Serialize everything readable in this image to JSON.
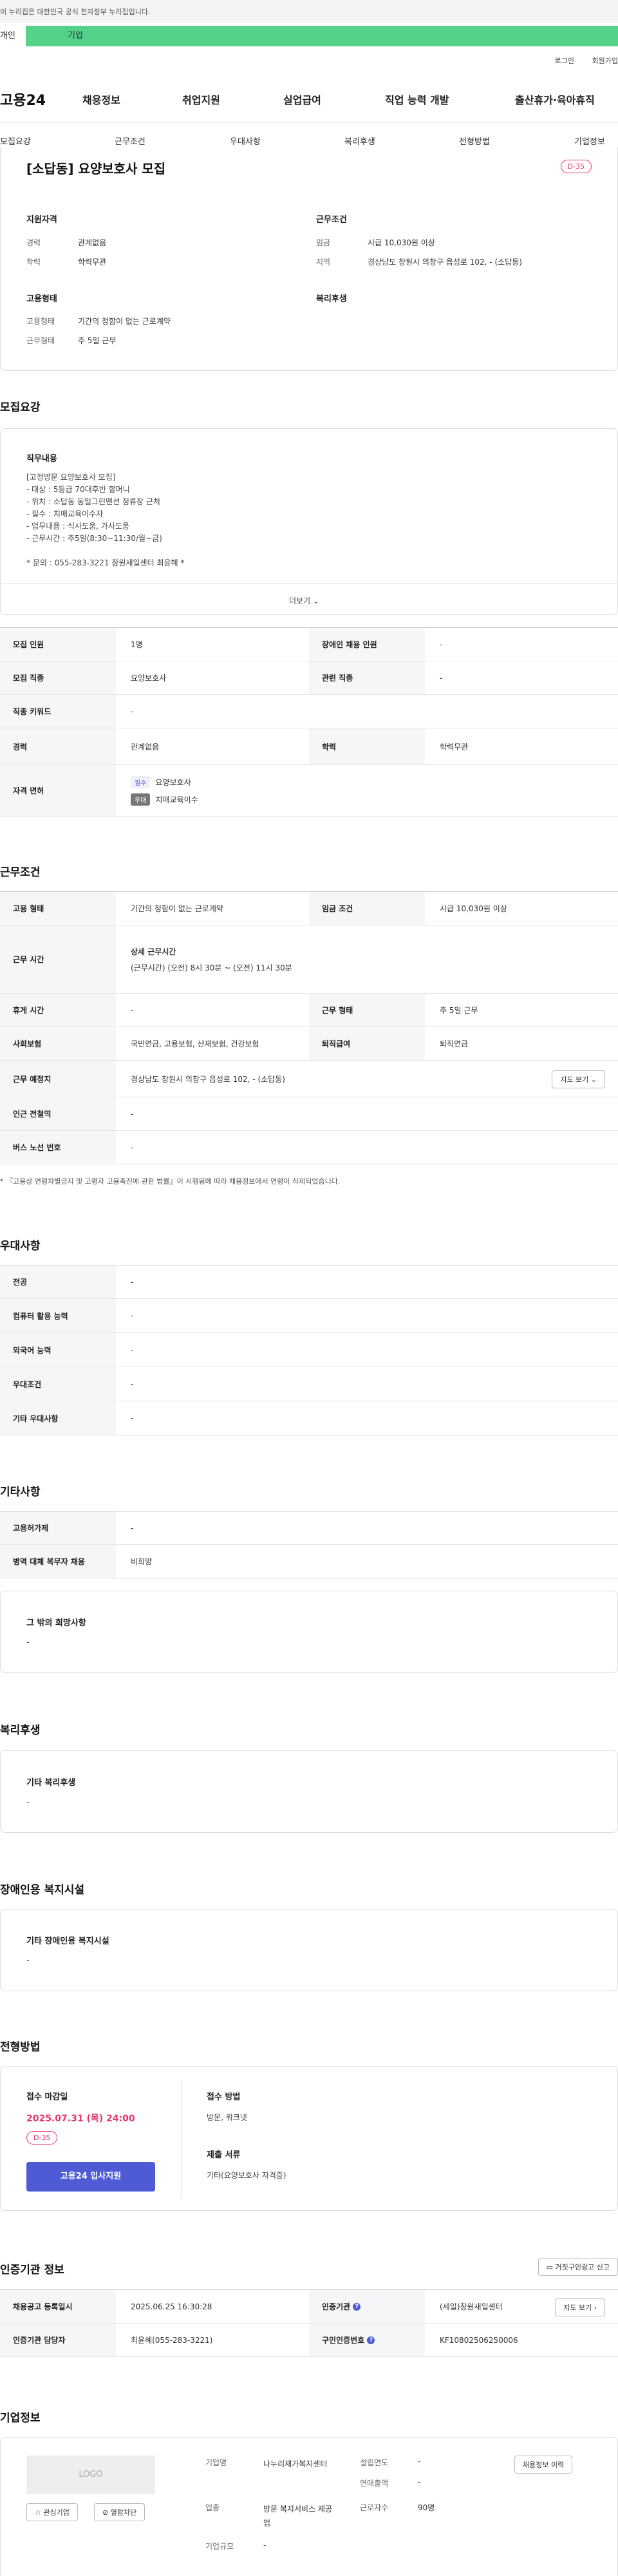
{
  "gov_banner": "이 누리집은 대한민국 공식 전자정부 누리집입니다.",
  "member_tabs": {
    "person": "개인",
    "company": "기업"
  },
  "util": {
    "login": "로그인",
    "join": "회원가입"
  },
  "logo": "고용24",
  "gnb": [
    "채용정보",
    "취업지원",
    "실업급여",
    "직업 능력 개발",
    "출산휴가·육아휴직"
  ],
  "sub_tabs": [
    "모집요강",
    "근무조건",
    "우대사항",
    "복리후생",
    "전형방법",
    "기업정보"
  ],
  "summary": {
    "title": "[소답동] 요양보호사 모집",
    "dday": "D-35",
    "qual_title": "지원자격",
    "career_label": "경력",
    "career": "관계없음",
    "edu_label": "학력",
    "edu": "학력무관",
    "employ_title": "고용형태",
    "employ_type_label": "고용형태",
    "employ_type": "기간의 정함이 없는 근로계약",
    "work_form_label": "근무형태",
    "work_form": "주 5일 근무",
    "cond_title": "근무조건",
    "wage_label": "임금",
    "wage": "시급 10,030원 이상",
    "region_label": "지역",
    "region": "경상남도 창원시 의창구 읍성로 102, - (소답동)",
    "welfare_title": "복리후생"
  },
  "recruit": {
    "heading": "모집요강",
    "job_desc_title": "직무내용",
    "job_lines": [
      "[고정방문 요양보호사 모집]",
      "- 대상 : 5등급 70대후반 할머니",
      "- 위치 : 소답동 동일그린맨션 정류장 근처",
      "- 필수 : 치매교육이수자",
      "- 업무내용 : 식사도움, 가사도움",
      "- 근무시간 : 주5일(8:30~11:30/월~금)",
      "",
      "* 문의 : 055-283-3221 창원새일센터 최윤혜 *"
    ],
    "more": "더보기",
    "rows": {
      "headcount_label": "모집 인원",
      "headcount": "1명",
      "disabled_label": "장애인 채용 인원",
      "disabled": "-",
      "job_label": "모집 직종",
      "job": "요양보호사",
      "related_label": "관련 직종",
      "related": "-",
      "keyword_label": "직종 키워드",
      "keyword": "-",
      "career_label": "경력",
      "career": "관계없음",
      "edu_label": "학력",
      "edu": "학력무관",
      "license_label": "자격 면허",
      "license1_tag": "필수",
      "license1": "요양보호사",
      "license2_tag": "우대",
      "license2": "치매교육이수"
    }
  },
  "conditions": {
    "heading": "근무조건",
    "employ_label": "고용 형태",
    "employ": "기간의 정함이 없는 근로계약",
    "wage_label": "임금 조건",
    "wage": "시급 10,030원 이상",
    "hours_label": "근무 시간",
    "hours_title": "상세 근무시간",
    "hours": "(근무시간) (오전) 8시 30분 ~ (오전) 11시 30분",
    "rest_label": "휴게 시간",
    "rest": "-",
    "form_label": "근무 형태",
    "form": "주 5일 근무",
    "insurance_label": "사회보험",
    "insurance": "국민연금, 고용보험, 산재보험, 건강보험",
    "severance_label": "퇴직급여",
    "severance": "퇴직연금",
    "place_label": "근무 예정지",
    "place": "경상남도 창원시 의창구 읍성로 102, - (소답동)",
    "map_btn": "지도 보기",
    "subway_label": "인근 전철역",
    "subway": "-",
    "bus_label": "버스 노선 번호",
    "bus": "-",
    "note": "* 『고용상 연령차별금지 및 고령자 고용촉진에 관한 법률』이 시행됨에 따라 채용정보에서 연령이 삭제되었습니다."
  },
  "pref": {
    "heading": "우대사항",
    "major_label": "전공",
    "major": "-",
    "computer_label": "컴퓨터 활용 능력",
    "computer": "-",
    "lang_label": "외국어 능력",
    "lang": "-",
    "cond_label": "우대조건",
    "cond": "-",
    "etc_label": "기타 우대사항",
    "etc": "-"
  },
  "etc": {
    "heading": "기타사항",
    "permit_label": "고용허가제",
    "permit": "-",
    "military_label": "병역 대체 복무자 채용",
    "military": "비희망",
    "hope_title": "그 밖의 희망사항",
    "hope": "-"
  },
  "welfare": {
    "heading": "복리후생",
    "title": "기타 복리후생",
    "value": "-"
  },
  "facility": {
    "heading": "장애인용 복지시설",
    "title": "기타 장애인용 복지시설",
    "value": "-"
  },
  "selection": {
    "heading": "전형방법",
    "deadline_title": "접수 마감일",
    "deadline": "2025.07.31 (목) 24:00",
    "dday": "D-35",
    "apply_btn": "고용24 입사지원",
    "method_title": "접수 방법",
    "method": "방문, 워크넷",
    "docs_title": "제출 서류",
    "docs": "기타(요양보호사 자격증)"
  },
  "cert": {
    "heading": "인증기관 정보",
    "report_btn": "거짓구인광고 신고",
    "reg_label": "채용공고 등록일시",
    "reg": "2025.06.25 16:30:28",
    "org_label": "인증기관",
    "org": "(세일)창원새일센터",
    "map_btn": "지도 보기",
    "manager_label": "인증기관 담당자",
    "manager": "최윤혜(055-283-3221)",
    "num_label": "구인인증번호",
    "num": "KF10802506250006"
  },
  "company": {
    "heading": "기업정보",
    "logo": "LOGO",
    "fav_btn": "관심기업",
    "block_btn": "열람차단",
    "name_label": "기업명",
    "name": "나누리재가복지센터",
    "year_label": "설립연도",
    "year": "-",
    "sales_label": "연매출액",
    "sales": "-",
    "industry_label": "업종",
    "industry": "방문 복지서비스 제공업",
    "staff_label": "근로자수",
    "staff": "90명",
    "scale_label": "기업규모",
    "scale": "-",
    "history_btn": "채용정보 이력"
  },
  "colors": {
    "accent": "#4f5bd5",
    "dday": "#e8336b",
    "company_tab": "#55d28a"
  }
}
